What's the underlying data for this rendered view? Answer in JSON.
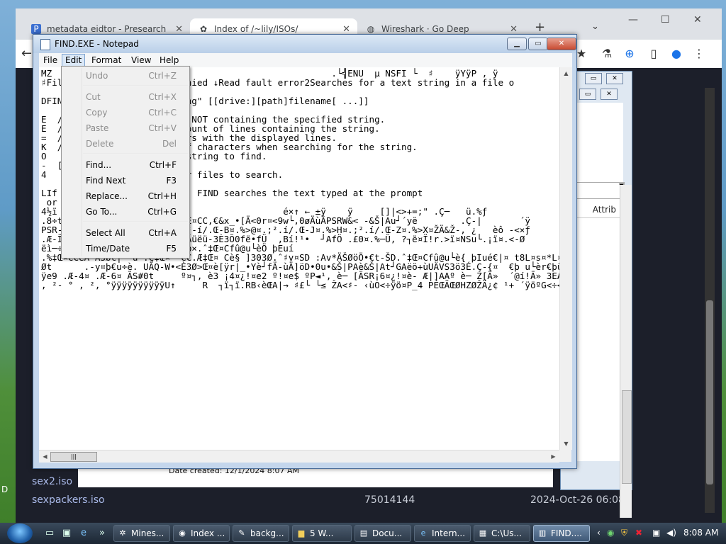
{
  "browser": {
    "tabs": [
      {
        "label": "metadata eidtor - Presearch",
        "icon": "presearch-icon"
      },
      {
        "label": "Index of /~lily/ISOs/",
        "icon": "puzzle-icon"
      },
      {
        "label": "Wireshark · Go Deep",
        "icon": "globe-icon"
      }
    ],
    "new_tab": "+",
    "page": {
      "rows": [
        {
          "name": "sex2.iso",
          "size": "",
          "date": ""
        },
        {
          "name": "sexpackers.iso",
          "size": "75014144",
          "date": "2024-Oct-26 06:08"
        }
      ]
    }
  },
  "explorer": {
    "column_header": "Attrib",
    "date_created_label": "Date created:",
    "date_created_value": "12/1/2024 8:07 AM"
  },
  "notepad": {
    "title": "FIND.EXE - Notepad",
    "menu": [
      "File",
      "Edit",
      "Format",
      "View",
      "Help"
    ],
    "content": "MZ                                                    .└╣ENU  µ NSFI └  ♯    ÿYÿΡ , ÿ\n♯Fil                  ss denied ↓Read fault error2Searches for a text string in a file o\n\nDFIN                  \"string\" [[drive:][path]filename[ ...]]\n\nE  /                  lines NOT containing the specified string.\nE  /                  the count of lines containing the string.\n=  /                  numbers with the displayed lines.\nK  /                  ase of characters when searching for the string.\nO                     text string to find.\n-  [\n4                     ile or files to search.\n\nLIf                   ified, FIND searches the text typed at the prompt\n or                   mand.\n4½ï                                          é×↑ ← ±ÿ    ÿ     []|<>+=;\" .Ç─   ü.%ƒ\n.8÷t                 .<] .ŽE¤CC,€&x_•[Ä<0r¤<9w└,0øÄùÂPSRW&< -&Š|Au┘´yë        .Ç-|       ´ÿ\nPSR-                  .%><¤²-í/.Œ-B¤.%>@¤.;².í/.Œ-J¤.%>H¤.;².í/.Œ-Z¤.%>X¤ŽÄ&Ž-, ¿   èô -<×ƒ\n.Æ-Ï                 _z[XÄƒÄüëü-3È3Ö0fë•fÜ  ,Bí!¹•  ┘AfÖ .£0¤.%─Ü, ?┐ë¤Ï!r.>ï¤NSu└.¡ï¤.<-Ø\nëì─÷            .;¡¤.Ç-§ ëìb×.ˆ‡Œ¤Cfû@u└èÖ þEuí\n.%‡Œ¤CCëA Â3Ø€|- u└.Ç‡Œ¤ -CC.Æ‡Œ¤ Cè§ ]303Ø.ˆ♯v¤SD :Av*ÄŠØöÖ•€t-ŠD.ˆ‡Œ¤Cfû@u└è{ þIué€|¤ t8L¤s¤*L¤\nØt      .-y¤þ€u÷è. UÄQ-W•<È3Ø>Œ¤è[ÿr|_•Yè┘fÄ-ùÄ]öD•0u•&Š|PAè&Š|At┘GAëö+ùUÄVS3ö3É.Ç-{¤  €þ u└èr€þü\nÿe9 .Æ-4¤ .Æ-6¤ ÄS#0t     º¤┐, è3 ¡4¤¿!¤e2 º!¤e$ ºP◄¹, è─ [ÄSR¡6¤¿!¤è- Æ|]AAº è─ Z[Ä»  ´@í!Ä» 3EA\n, ²- ° , ², °ÿÿÿÿÿÿÿÿÿÿU↑     R  ┐ï┐ï.RB‹èŒA|→ ♯£└ └≤ ŽA<♯- ‹ùO<÷ÿö¤P_4 PÉŒÄŒØHZØŽÄ¿¢ ¹+ ´ÿöºG<÷<ÄH"
  },
  "edit_menu": {
    "items": [
      {
        "label": "Undo",
        "shortcut": "Ctrl+Z",
        "disabled": true
      },
      {
        "label": "Cut",
        "shortcut": "Ctrl+X",
        "disabled": true
      },
      {
        "label": "Copy",
        "shortcut": "Ctrl+C",
        "disabled": true
      },
      {
        "label": "Paste",
        "shortcut": "Ctrl+V",
        "disabled": true
      },
      {
        "label": "Delete",
        "shortcut": "Del",
        "disabled": true
      },
      {
        "label": "Find...",
        "shortcut": "Ctrl+F",
        "disabled": false
      },
      {
        "label": "Find Next",
        "shortcut": "F3",
        "disabled": false
      },
      {
        "label": "Replace...",
        "shortcut": "Ctrl+H",
        "disabled": false
      },
      {
        "label": "Go To...",
        "shortcut": "Ctrl+G",
        "disabled": false
      },
      {
        "label": "Select All",
        "shortcut": "Ctrl+A",
        "disabled": false
      },
      {
        "label": "Time/Date",
        "shortcut": "F5",
        "disabled": false
      }
    ]
  },
  "taskbar": {
    "buttons": [
      {
        "label": "Mines...",
        "icon": "gear-icon"
      },
      {
        "label": "Index ...",
        "icon": "chrome-icon"
      },
      {
        "label": "backg...",
        "icon": "brush-icon"
      },
      {
        "label": "5 W...",
        "icon": "folder-icon"
      },
      {
        "label": "Docu...",
        "icon": "document-icon"
      },
      {
        "label": "Intern...",
        "icon": "ie-icon"
      },
      {
        "label": "C:\\Us...",
        "icon": "console-icon"
      },
      {
        "label": "FIND....",
        "icon": "notepad-icon"
      }
    ],
    "clock": "8:08 AM"
  },
  "desktop": {
    "left_letter": "D"
  }
}
